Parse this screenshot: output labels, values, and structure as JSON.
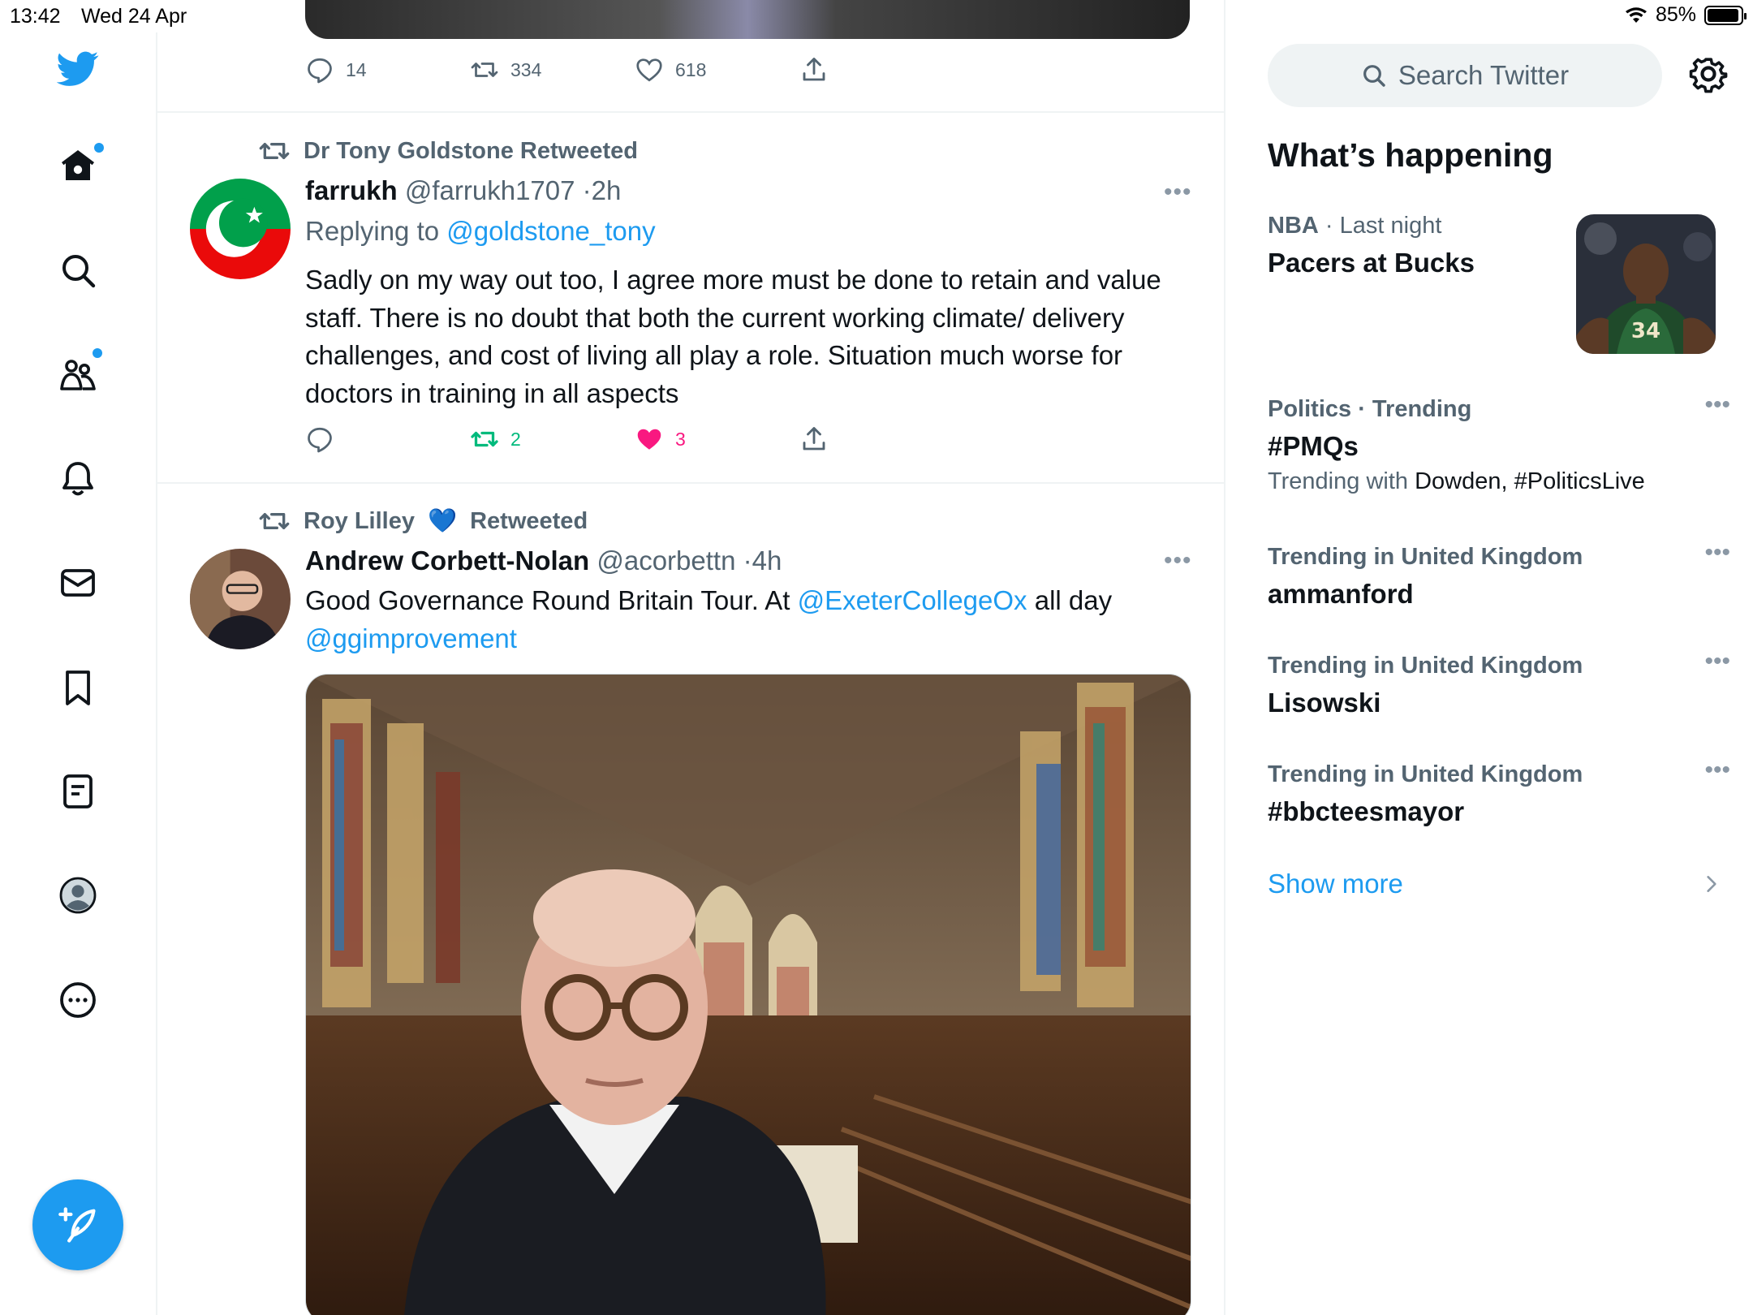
{
  "status": {
    "time": "13:42",
    "date": "Wed 24 Apr",
    "battery": "85%",
    "battery_level": 0.85
  },
  "nav": {
    "items": [
      "twitter-logo",
      "home",
      "explore",
      "communities",
      "notifications",
      "messages",
      "bookmarks",
      "lists",
      "profile",
      "more"
    ],
    "compose_label": "Tweet"
  },
  "colors": {
    "accent": "#1d9bf0",
    "retweet_green": "#00ba7c",
    "like_pink": "#f91880",
    "muted": "#536471"
  },
  "feed": {
    "prev_tweet": {
      "replies": "14",
      "retweets": "334",
      "likes": "618"
    },
    "tweet1": {
      "retweeted_by": "Dr Tony Goldstone Retweeted",
      "name": "farrukh",
      "handle": "@farrukh1707",
      "sep": "·",
      "time": "2h",
      "replying_prefix": "Replying to",
      "replying_handle": "@goldstone_tony",
      "text": "Sadly on my way out too, I agree more must be done to retain and value staff. There is no doubt that both the current working climate/ delivery challenges, and cost of living all play a role. Situation much worse for doctors in training in all aspects",
      "replies": "",
      "retweets": "2",
      "likes": "3"
    },
    "tweet2": {
      "retweeted_by_name": "Roy Lilley",
      "retweeted_by_emoji": "💙",
      "retweeted_suffix": "Retweeted",
      "name": "Andrew Corbett-Nolan",
      "handle": "@acorbettn",
      "sep": "·",
      "time": "4h",
      "text_prefix": "Good Governance Round Britain Tour. At",
      "mention1": "@ExeterCollegeOx",
      "text_mid": "all day",
      "mention2": "@ggimprovement"
    }
  },
  "sidebar": {
    "search_placeholder": "Search Twitter",
    "section_title": "What’s happening",
    "trends": [
      {
        "context": "NBA",
        "context_rest": "· Last night",
        "title": "Pacers at Bucks"
      },
      {
        "context": "Politics · Trending",
        "title": "#PMQs",
        "sub_prefix": "Trending with",
        "sub_rest": "Dowden, #PoliticsLive"
      },
      {
        "context": "Trending in United Kingdom",
        "title": "ammanford"
      },
      {
        "context": "Trending in United Kingdom",
        "title": "Lisowski"
      },
      {
        "context": "Trending in United Kingdom",
        "title": "#bbcteesmayor"
      }
    ],
    "show_more": "Show more"
  }
}
